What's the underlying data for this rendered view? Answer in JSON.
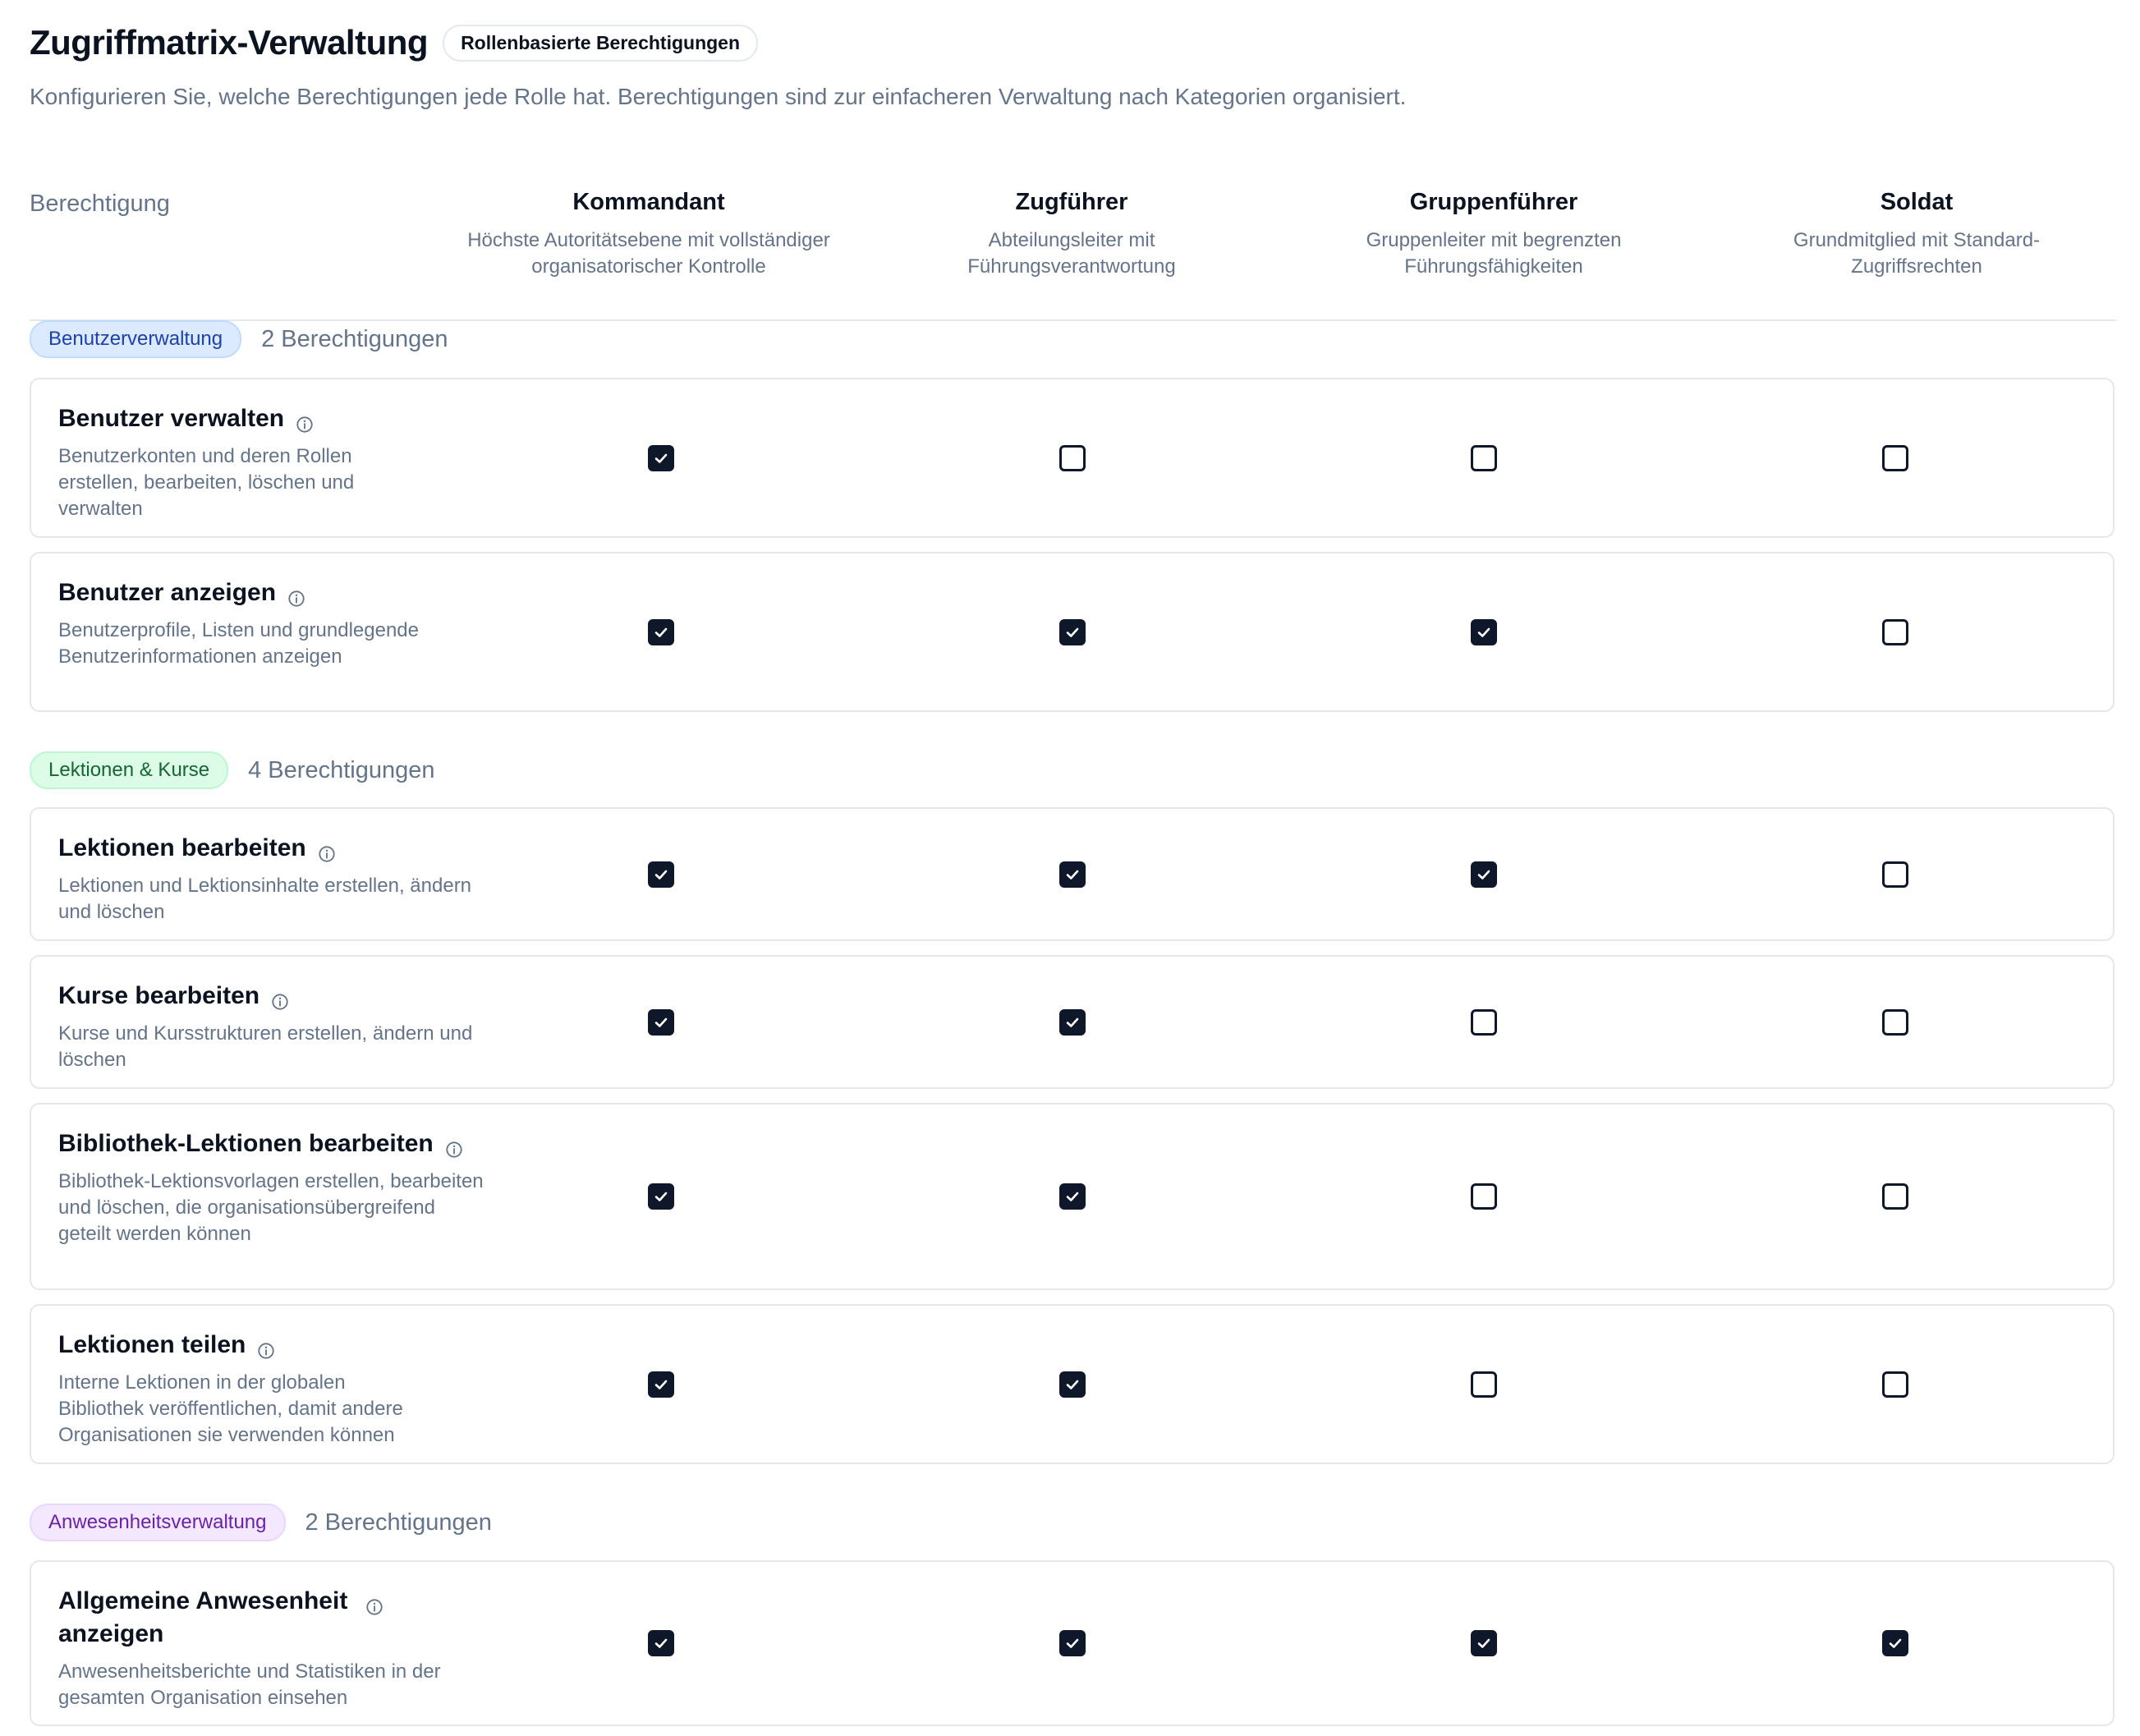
{
  "header": {
    "title": "Zugriffmatrix-Verwaltung",
    "badge": "Rollenbasierte Berechtigungen",
    "subtitle": "Konfigurieren Sie, welche Berechtigungen jede Rolle hat. Berechtigungen sind zur einfacheren Verwaltung nach Kategorien organisiert."
  },
  "table": {
    "permission_header": "Berechtigung",
    "roles": [
      {
        "name": "Kommandant",
        "desc": "Höchste Autoritätsebene mit vollständiger organisatorischer Kontrolle"
      },
      {
        "name": "Zugführer",
        "desc": "Abteilungsleiter mit Führungsverantwortung"
      },
      {
        "name": "Gruppenführer",
        "desc": "Gruppenleiter mit begrenzten Führungsfähigkeiten"
      },
      {
        "name": "Soldat",
        "desc": "Grundmitglied mit Standard-Zugriffsrechten"
      }
    ]
  },
  "categories": [
    {
      "label": "Benutzerverwaltung",
      "count": "2 Berechtigungen",
      "colors": {
        "bg": "#dbeafe",
        "border": "#bfdbfe",
        "text": "#1e40af"
      },
      "permissions": [
        {
          "title": "Benutzer verwalten",
          "desc": "Benutzerkonten und deren Rollen erstellen, bearbeiten, löschen und verwalten",
          "checks": [
            true,
            false,
            false,
            false
          ]
        },
        {
          "title": "Benutzer anzeigen",
          "desc": "Benutzerprofile, Listen und grundlegende Benutzerinformationen anzeigen",
          "checks": [
            true,
            true,
            true,
            false
          ]
        }
      ]
    },
    {
      "label": "Lektionen & Kurse",
      "count": "4 Berechtigungen",
      "colors": {
        "bg": "#dcfce7",
        "border": "#bbf7d0",
        "text": "#166534"
      },
      "permissions": [
        {
          "title": "Lektionen bearbeiten",
          "desc": "Lektionen und Lektionsinhalte erstellen, ändern und löschen",
          "checks": [
            true,
            true,
            true,
            false
          ]
        },
        {
          "title": "Kurse bearbeiten",
          "desc": "Kurse und Kursstrukturen erstellen, ändern und löschen",
          "checks": [
            true,
            true,
            false,
            false
          ]
        },
        {
          "title": "Bibliothek-Lektionen bearbeiten",
          "desc": "Bibliothek-Lektionsvorlagen erstellen, bearbeiten und löschen, die organisationsübergreifend geteilt werden können",
          "checks": [
            true,
            true,
            false,
            false
          ]
        },
        {
          "title": "Lektionen teilen",
          "desc": "Interne Lektionen in der globalen Bibliothek veröffentlichen, damit andere Organisationen sie verwenden können",
          "checks": [
            true,
            true,
            false,
            false
          ]
        }
      ]
    },
    {
      "label": "Anwesenheitsverwaltung",
      "count": "2 Berechtigungen",
      "colors": {
        "bg": "#f3e8ff",
        "border": "#e9d5ff",
        "text": "#6b21a8"
      },
      "permissions": [
        {
          "title": "Allgemeine Anwesenheit anzeigen",
          "desc": "Anwesenheitsberichte und Statistiken in der gesamten Organisation einsehen",
          "checks": [
            true,
            true,
            true,
            true
          ]
        }
      ]
    }
  ]
}
